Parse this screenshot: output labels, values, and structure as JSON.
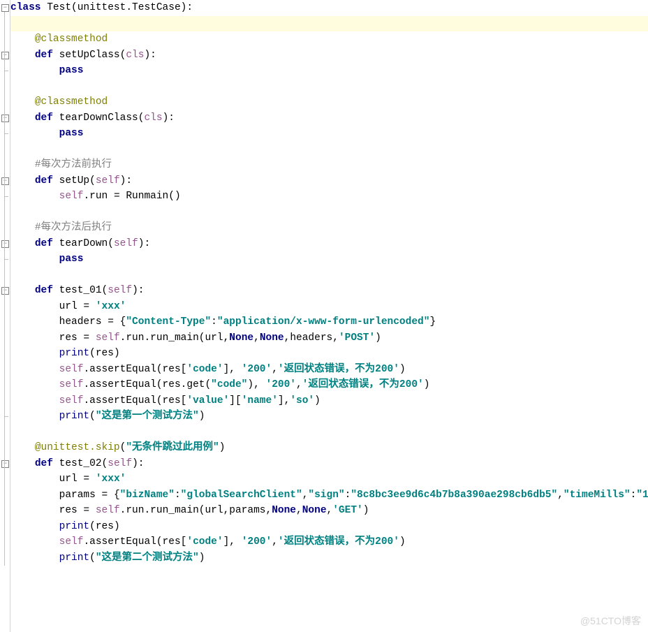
{
  "watermark": "@51CTO博客",
  "lines": [
    {
      "indent": 0,
      "tokens": [
        [
          "kw",
          "class"
        ],
        [
          "deft",
          " Test(unittest.TestCase):"
        ]
      ],
      "fold_open": true,
      "hl": false
    },
    {
      "indent": 0,
      "tokens": [],
      "hl": true
    },
    {
      "indent": 1,
      "tokens": [
        [
          "dec",
          "@classmethod"
        ]
      ]
    },
    {
      "indent": 1,
      "tokens": [
        [
          "kw",
          "def"
        ],
        [
          "deft",
          " setUpClass("
        ],
        [
          "param",
          "cls"
        ],
        [
          "deft",
          "):"
        ]
      ],
      "fold_open": true
    },
    {
      "indent": 2,
      "tokens": [
        [
          "kw",
          "pass"
        ]
      ],
      "fold_end": true
    },
    {
      "indent": 0,
      "tokens": []
    },
    {
      "indent": 1,
      "tokens": [
        [
          "dec",
          "@classmethod"
        ]
      ]
    },
    {
      "indent": 1,
      "tokens": [
        [
          "kw",
          "def"
        ],
        [
          "deft",
          " tearDownClass("
        ],
        [
          "param",
          "cls"
        ],
        [
          "deft",
          "):"
        ]
      ],
      "fold_open": true
    },
    {
      "indent": 2,
      "tokens": [
        [
          "kw",
          "pass"
        ]
      ],
      "fold_end": true
    },
    {
      "indent": 0,
      "tokens": []
    },
    {
      "indent": 1,
      "tokens": [
        [
          "cmt",
          "#每次方法前执行"
        ]
      ]
    },
    {
      "indent": 1,
      "tokens": [
        [
          "kw",
          "def"
        ],
        [
          "deft",
          " setUp("
        ],
        [
          "param",
          "self"
        ],
        [
          "deft",
          "):"
        ]
      ],
      "fold_open": true
    },
    {
      "indent": 2,
      "tokens": [
        [
          "self",
          "self"
        ],
        [
          "deft",
          ".run = Runmain()"
        ]
      ],
      "fold_end": true
    },
    {
      "indent": 0,
      "tokens": []
    },
    {
      "indent": 1,
      "tokens": [
        [
          "cmt",
          "#每次方法后执行"
        ]
      ]
    },
    {
      "indent": 1,
      "tokens": [
        [
          "kw",
          "def"
        ],
        [
          "deft",
          " tearDown("
        ],
        [
          "param",
          "self"
        ],
        [
          "deft",
          "):"
        ]
      ],
      "fold_open": true
    },
    {
      "indent": 2,
      "tokens": [
        [
          "kw",
          "pass"
        ]
      ],
      "fold_end": true
    },
    {
      "indent": 0,
      "tokens": []
    },
    {
      "indent": 1,
      "tokens": [
        [
          "kw",
          "def"
        ],
        [
          "deft",
          " test_01("
        ],
        [
          "param",
          "self"
        ],
        [
          "deft",
          "):"
        ]
      ],
      "fold_open": true
    },
    {
      "indent": 2,
      "tokens": [
        [
          "deft",
          "url = "
        ],
        [
          "str",
          "'xxx'"
        ]
      ]
    },
    {
      "indent": 2,
      "tokens": [
        [
          "deft",
          "headers = {"
        ],
        [
          "str",
          "\"Content-Type\""
        ],
        [
          "deft",
          ":"
        ],
        [
          "str",
          "\"application/x-www-form-urlencoded\""
        ],
        [
          "deft",
          "}"
        ]
      ]
    },
    {
      "indent": 2,
      "tokens": [
        [
          "deft",
          "res = "
        ],
        [
          "self",
          "self"
        ],
        [
          "deft",
          ".run.run_main(url,"
        ],
        [
          "none",
          "None"
        ],
        [
          "deft",
          ","
        ],
        [
          "none",
          "None"
        ],
        [
          "deft",
          ",headers,"
        ],
        [
          "str",
          "'POST'"
        ],
        [
          "deft",
          ")"
        ]
      ]
    },
    {
      "indent": 2,
      "tokens": [
        [
          "builtin",
          "print"
        ],
        [
          "deft",
          "(res)"
        ]
      ]
    },
    {
      "indent": 2,
      "tokens": [
        [
          "self",
          "self"
        ],
        [
          "deft",
          ".assertEqual(res["
        ],
        [
          "str",
          "'code'"
        ],
        [
          "deft",
          "], "
        ],
        [
          "str",
          "'200'"
        ],
        [
          "deft",
          ","
        ],
        [
          "str",
          "'返回状态错误，不为200'"
        ],
        [
          "deft",
          ")"
        ]
      ]
    },
    {
      "indent": 2,
      "tokens": [
        [
          "self",
          "self"
        ],
        [
          "deft",
          ".assertEqual(res.get("
        ],
        [
          "str",
          "\"code\""
        ],
        [
          "deft",
          "), "
        ],
        [
          "str",
          "'200'"
        ],
        [
          "deft",
          ","
        ],
        [
          "str",
          "'返回状态错误，不为200'"
        ],
        [
          "deft",
          ")"
        ]
      ]
    },
    {
      "indent": 2,
      "tokens": [
        [
          "self",
          "self"
        ],
        [
          "deft",
          ".assertEqual(res["
        ],
        [
          "str",
          "'value'"
        ],
        [
          "deft",
          "]["
        ],
        [
          "str",
          "'name'"
        ],
        [
          "deft",
          "],"
        ],
        [
          "str",
          "'so'"
        ],
        [
          "deft",
          ")"
        ]
      ]
    },
    {
      "indent": 2,
      "tokens": [
        [
          "builtin",
          "print"
        ],
        [
          "deft",
          "("
        ],
        [
          "str",
          "\"这是第一个测试方法\""
        ],
        [
          "deft",
          ")"
        ]
      ],
      "fold_end": true
    },
    {
      "indent": 0,
      "tokens": []
    },
    {
      "indent": 1,
      "tokens": [
        [
          "dec",
          "@unittest.skip"
        ],
        [
          "deft",
          "("
        ],
        [
          "str",
          "\"无条件跳过此用例\""
        ],
        [
          "deft",
          ")"
        ]
      ]
    },
    {
      "indent": 1,
      "tokens": [
        [
          "kw",
          "def"
        ],
        [
          "deft",
          " test_02("
        ],
        [
          "param",
          "self"
        ],
        [
          "deft",
          "):"
        ]
      ],
      "fold_open": true
    },
    {
      "indent": 2,
      "tokens": [
        [
          "deft",
          "url = "
        ],
        [
          "str",
          "'xxx'"
        ]
      ]
    },
    {
      "indent": 2,
      "tokens": [
        [
          "deft",
          "params = {"
        ],
        [
          "str",
          "\"bizName\""
        ],
        [
          "deft",
          ":"
        ],
        [
          "str",
          "\"globalSearchClient\""
        ],
        [
          "deft",
          ","
        ],
        [
          "str",
          "\"sign\""
        ],
        [
          "deft",
          ":"
        ],
        [
          "str",
          "\"8c8bc3ee9d6c4b7b8a390ae298cb6db5\""
        ],
        [
          "deft",
          ","
        ],
        [
          "str",
          "\"timeMills\""
        ],
        [
          "deft",
          ":"
        ],
        [
          "str",
          "\"1"
        ]
      ]
    },
    {
      "indent": 2,
      "tokens": [
        [
          "deft",
          "res = "
        ],
        [
          "self",
          "self"
        ],
        [
          "deft",
          ".run.run_main(url,params,"
        ],
        [
          "none",
          "None"
        ],
        [
          "deft",
          ","
        ],
        [
          "none",
          "None"
        ],
        [
          "deft",
          ","
        ],
        [
          "str",
          "'GET'"
        ],
        [
          "deft",
          ")"
        ]
      ]
    },
    {
      "indent": 2,
      "tokens": [
        [
          "builtin",
          "print"
        ],
        [
          "deft",
          "(res)"
        ]
      ]
    },
    {
      "indent": 2,
      "tokens": [
        [
          "self",
          "self"
        ],
        [
          "deft",
          ".assertEqual(res["
        ],
        [
          "str",
          "'code'"
        ],
        [
          "deft",
          "], "
        ],
        [
          "str",
          "'200'"
        ],
        [
          "deft",
          ","
        ],
        [
          "str",
          "'返回状态错误，不为200'"
        ],
        [
          "deft",
          ")"
        ]
      ]
    },
    {
      "indent": 2,
      "tokens": [
        [
          "builtin",
          "print"
        ],
        [
          "deft",
          "("
        ],
        [
          "str",
          "\"这是第二个测试方法\""
        ],
        [
          "deft",
          ")"
        ]
      ]
    }
  ]
}
